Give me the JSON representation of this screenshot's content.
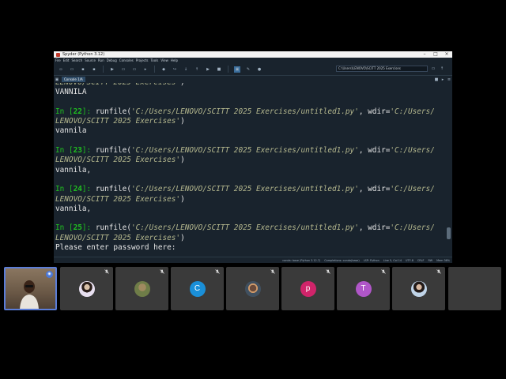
{
  "window": {
    "title": "Spyder (Python 3.12)",
    "menu": [
      "File",
      "Edit",
      "Search",
      "Source",
      "Run",
      "Debug",
      "Consoles",
      "Projects",
      "Tools",
      "View",
      "Help"
    ],
    "working_dir": "C:\\Users\\LENOVO\\SCITT 2025 Exercises",
    "console_tab": "Console 1/A"
  },
  "console": {
    "file_path": "C:/Users/LENOVO/SCITT 2025 Exercises/untitled1.py",
    "wdir_head": "C:/Users/",
    "wdir_tail": "LENOVO/SCITT 2025 Exercises",
    "top_partial": {
      "rest": "')",
      "output": "VANNILA"
    },
    "entries": [
      {
        "n": "22",
        "output": "vannila"
      },
      {
        "n": "23",
        "output": "vannila,"
      },
      {
        "n": "24",
        "output": "vannila,"
      },
      {
        "n": "25",
        "output": "Please enter password here:"
      }
    ],
    "runfile_label": "runfile(",
    "wdir_label": "wdir="
  },
  "status": {
    "items": [
      "conda: base (Python 3.12.7)",
      "Completions: conda(base)",
      "LSP: Python",
      "Line 5, Col 14",
      "UTF-8",
      "CRLF",
      "RW",
      "Mem 36%"
    ]
  },
  "meeting": {
    "tiles": [
      {
        "kind": "self"
      },
      {
        "kind": "photo",
        "style": "photo-a"
      },
      {
        "kind": "photo",
        "style": "photo-b"
      },
      {
        "kind": "letter",
        "letter": "C",
        "color": "#1a8fd8"
      },
      {
        "kind": "photo",
        "style": "photo-c"
      },
      {
        "kind": "letter",
        "letter": "p",
        "color": "#d0246a"
      },
      {
        "kind": "letter",
        "letter": "T",
        "color": "#b056c8"
      },
      {
        "kind": "photo",
        "style": "photo-d"
      },
      {
        "kind": "empty"
      }
    ]
  }
}
